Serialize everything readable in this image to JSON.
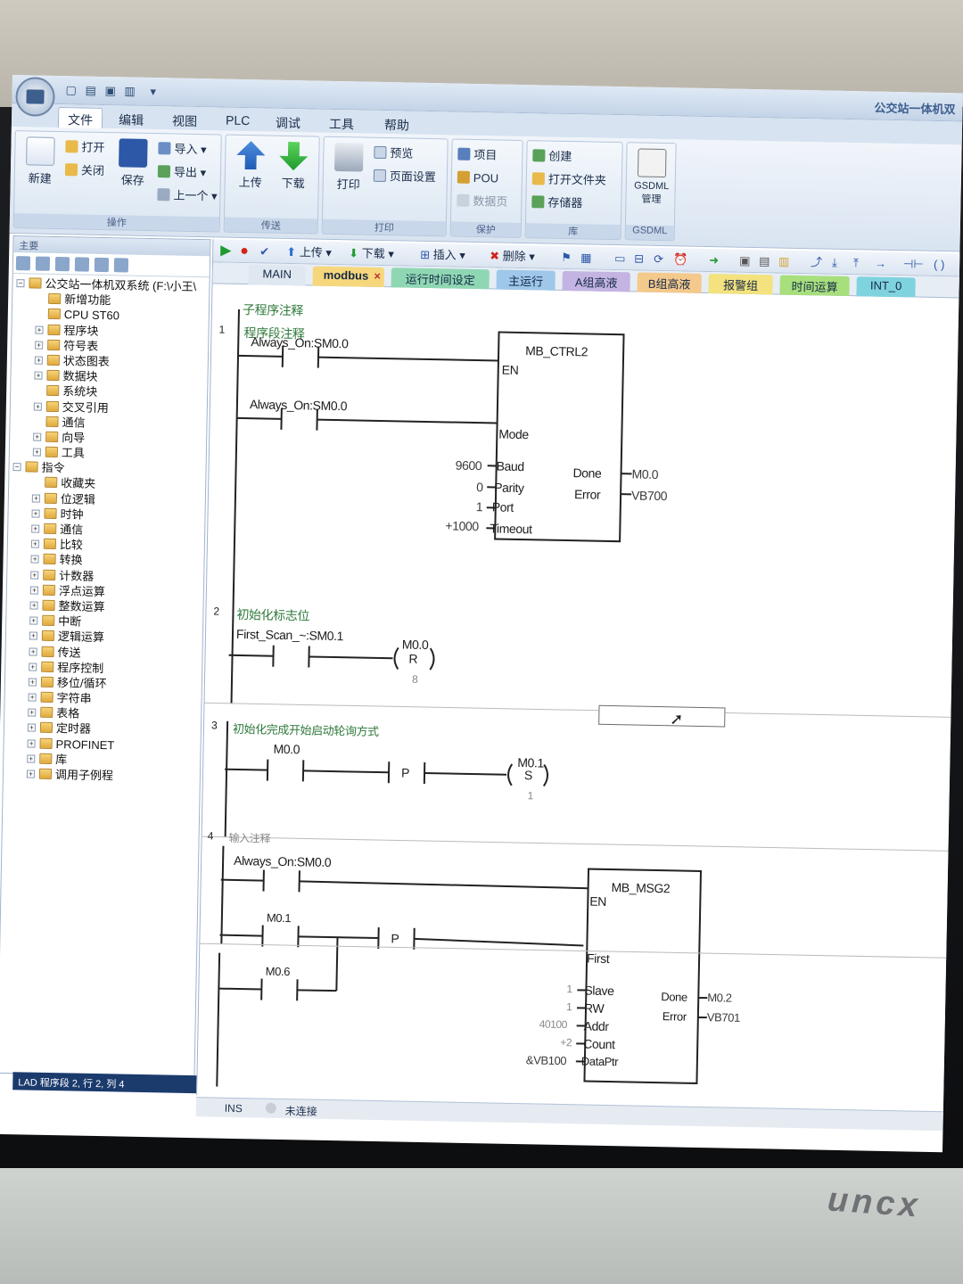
{
  "window": {
    "title": "公交站一体机双"
  },
  "menu": {
    "tabs": [
      "文件",
      "编辑",
      "视图",
      "PLC",
      "调试",
      "工具",
      "帮助"
    ]
  },
  "ribbon": {
    "new": "新建",
    "open": "打开",
    "close": "关闭",
    "save": "保存",
    "import": "导入",
    "export": "导出",
    "previous": "上一个",
    "group_operate": "操作",
    "upload": "上传",
    "download": "下载",
    "group_transfer": "传送",
    "print": "打印",
    "preview": "预览",
    "page_setup": "页面设置",
    "group_print": "打印",
    "project": "项目",
    "pou": "POU",
    "data_page": "数据页",
    "group_protect": "保护",
    "create": "创建",
    "open_folder": "打开文件夹",
    "memory": "存储器",
    "group_library": "库",
    "gsdml": "GSDML 管理",
    "group_gsdml": "GSDML"
  },
  "left_panel": {
    "head": "主要",
    "tree": [
      {
        "label": "公交站一体机双系统 (F:\\小王\\",
        "level": 0,
        "expander": "⊟"
      },
      {
        "label": "新增功能",
        "level": 1,
        "expander": ""
      },
      {
        "label": "CPU ST60",
        "level": 1,
        "expander": ""
      },
      {
        "label": "程序块",
        "level": 1,
        "expander": "⊞"
      },
      {
        "label": "符号表",
        "level": 1,
        "expander": "⊞"
      },
      {
        "label": "状态图表",
        "level": 1,
        "expander": "⊞"
      },
      {
        "label": "数据块",
        "level": 1,
        "expander": "⊞"
      },
      {
        "label": "系统块",
        "level": 1,
        "expander": ""
      },
      {
        "label": "交叉引用",
        "level": 1,
        "expander": "⊞"
      },
      {
        "label": "通信",
        "level": 1,
        "expander": ""
      },
      {
        "label": "向导",
        "level": 1,
        "expander": "⊞"
      },
      {
        "label": "工具",
        "level": 1,
        "expander": "⊞"
      },
      {
        "label": "指令",
        "level": 0,
        "expander": "⊟"
      },
      {
        "label": "收藏夹",
        "level": 1,
        "expander": ""
      },
      {
        "label": "位逻辑",
        "level": 1,
        "expander": "⊞"
      },
      {
        "label": "时钟",
        "level": 1,
        "expander": "⊞"
      },
      {
        "label": "通信",
        "level": 1,
        "expander": "⊞"
      },
      {
        "label": "比较",
        "level": 1,
        "expander": "⊞"
      },
      {
        "label": "转换",
        "level": 1,
        "expander": "⊞"
      },
      {
        "label": "计数器",
        "level": 1,
        "expander": "⊞"
      },
      {
        "label": "浮点运算",
        "level": 1,
        "expander": "⊞"
      },
      {
        "label": "整数运算",
        "level": 1,
        "expander": "⊞"
      },
      {
        "label": "中断",
        "level": 1,
        "expander": "⊞"
      },
      {
        "label": "逻辑运算",
        "level": 1,
        "expander": "⊞"
      },
      {
        "label": "传送",
        "level": 1,
        "expander": "⊞"
      },
      {
        "label": "程序控制",
        "level": 1,
        "expander": "⊞"
      },
      {
        "label": "移位/循环",
        "level": 1,
        "expander": "⊞"
      },
      {
        "label": "字符串",
        "level": 1,
        "expander": "⊞"
      },
      {
        "label": "表格",
        "level": 1,
        "expander": "⊞"
      },
      {
        "label": "定时器",
        "level": 1,
        "expander": "⊞"
      },
      {
        "label": "PROFINET",
        "level": 1,
        "expander": "⊞"
      },
      {
        "label": "库",
        "level": 1,
        "expander": "⊞"
      },
      {
        "label": "调用子例程",
        "level": 1,
        "expander": "⊞"
      }
    ],
    "status": "LAD 程序段 2, 行 2, 列 4"
  },
  "editor": {
    "toolbar": {
      "upload": "上传",
      "download": "下载",
      "insert": "插入",
      "delete": "删除"
    },
    "tabs": [
      {
        "label": "MAIN",
        "color": "#dfe7f1"
      },
      {
        "label": "modbus",
        "color": "#f6d77b"
      },
      {
        "label": "运行时间设定",
        "color": "#8fd7b3"
      },
      {
        "label": "主运行",
        "color": "#9fc7ea"
      },
      {
        "label": "A组高液",
        "color": "#c4b4e3"
      },
      {
        "label": "B组高液",
        "color": "#f4c98c"
      },
      {
        "label": "报警组",
        "color": "#f3e27e"
      },
      {
        "label": "时间运算",
        "color": "#a8df7d"
      },
      {
        "label": "INT_0",
        "color": "#7fd3df"
      }
    ],
    "tab_close": "×",
    "sub_comment": "子程序注释",
    "networks": [
      {
        "number": "1",
        "comment": "程序段注释"
      },
      {
        "number": "2",
        "comment": "初始化标志位"
      },
      {
        "number": "3",
        "comment": "初始化完成开始启动轮询方式"
      },
      {
        "number": "4",
        "comment": "输入注释"
      }
    ],
    "n1": {
      "contact1": "Always_On:SM0.0",
      "contact2": "Always_On:SM0.0",
      "block": "MB_CTRL2",
      "en": "EN",
      "mode": "Mode",
      "baud": "Baud",
      "baud_val": "9600",
      "parity": "Parity",
      "parity_val": "0",
      "port": "Port",
      "port_val": "1",
      "timeout": "Timeout",
      "timeout_val": "+1000",
      "done": "Done",
      "done_val": "M0.0",
      "error": "Error",
      "error_val": "VB700"
    },
    "n2": {
      "contact": "First_Scan_~:SM0.1",
      "coil_addr": "M0.0",
      "coil": "R",
      "coil_n": "8"
    },
    "n3": {
      "contact": "M0.0",
      "p": "P",
      "coil_addr": "M0.1",
      "coil": "S",
      "coil_n": "1"
    },
    "n4": {
      "contact1": "Always_On:SM0.0",
      "contact2": "M0.1",
      "contact3": "M0.6",
      "p": "P",
      "block": "MB_MSG2",
      "en": "EN",
      "first": "First",
      "slave": "Slave",
      "slave_val": "1",
      "rw": "RW",
      "rw_val": "1",
      "addr": "Addr",
      "addr_val": "40100",
      "count": "Count",
      "count_val": "+2",
      "dataptr": "DataPtr",
      "dataptr_val": "&VB100",
      "done": "Done",
      "done_val": "M0.2",
      "error": "Error",
      "error_val": "VB701"
    },
    "status": {
      "mode": "INS",
      "connection": "未连接"
    }
  },
  "monitor": {
    "brand": "uncx"
  }
}
